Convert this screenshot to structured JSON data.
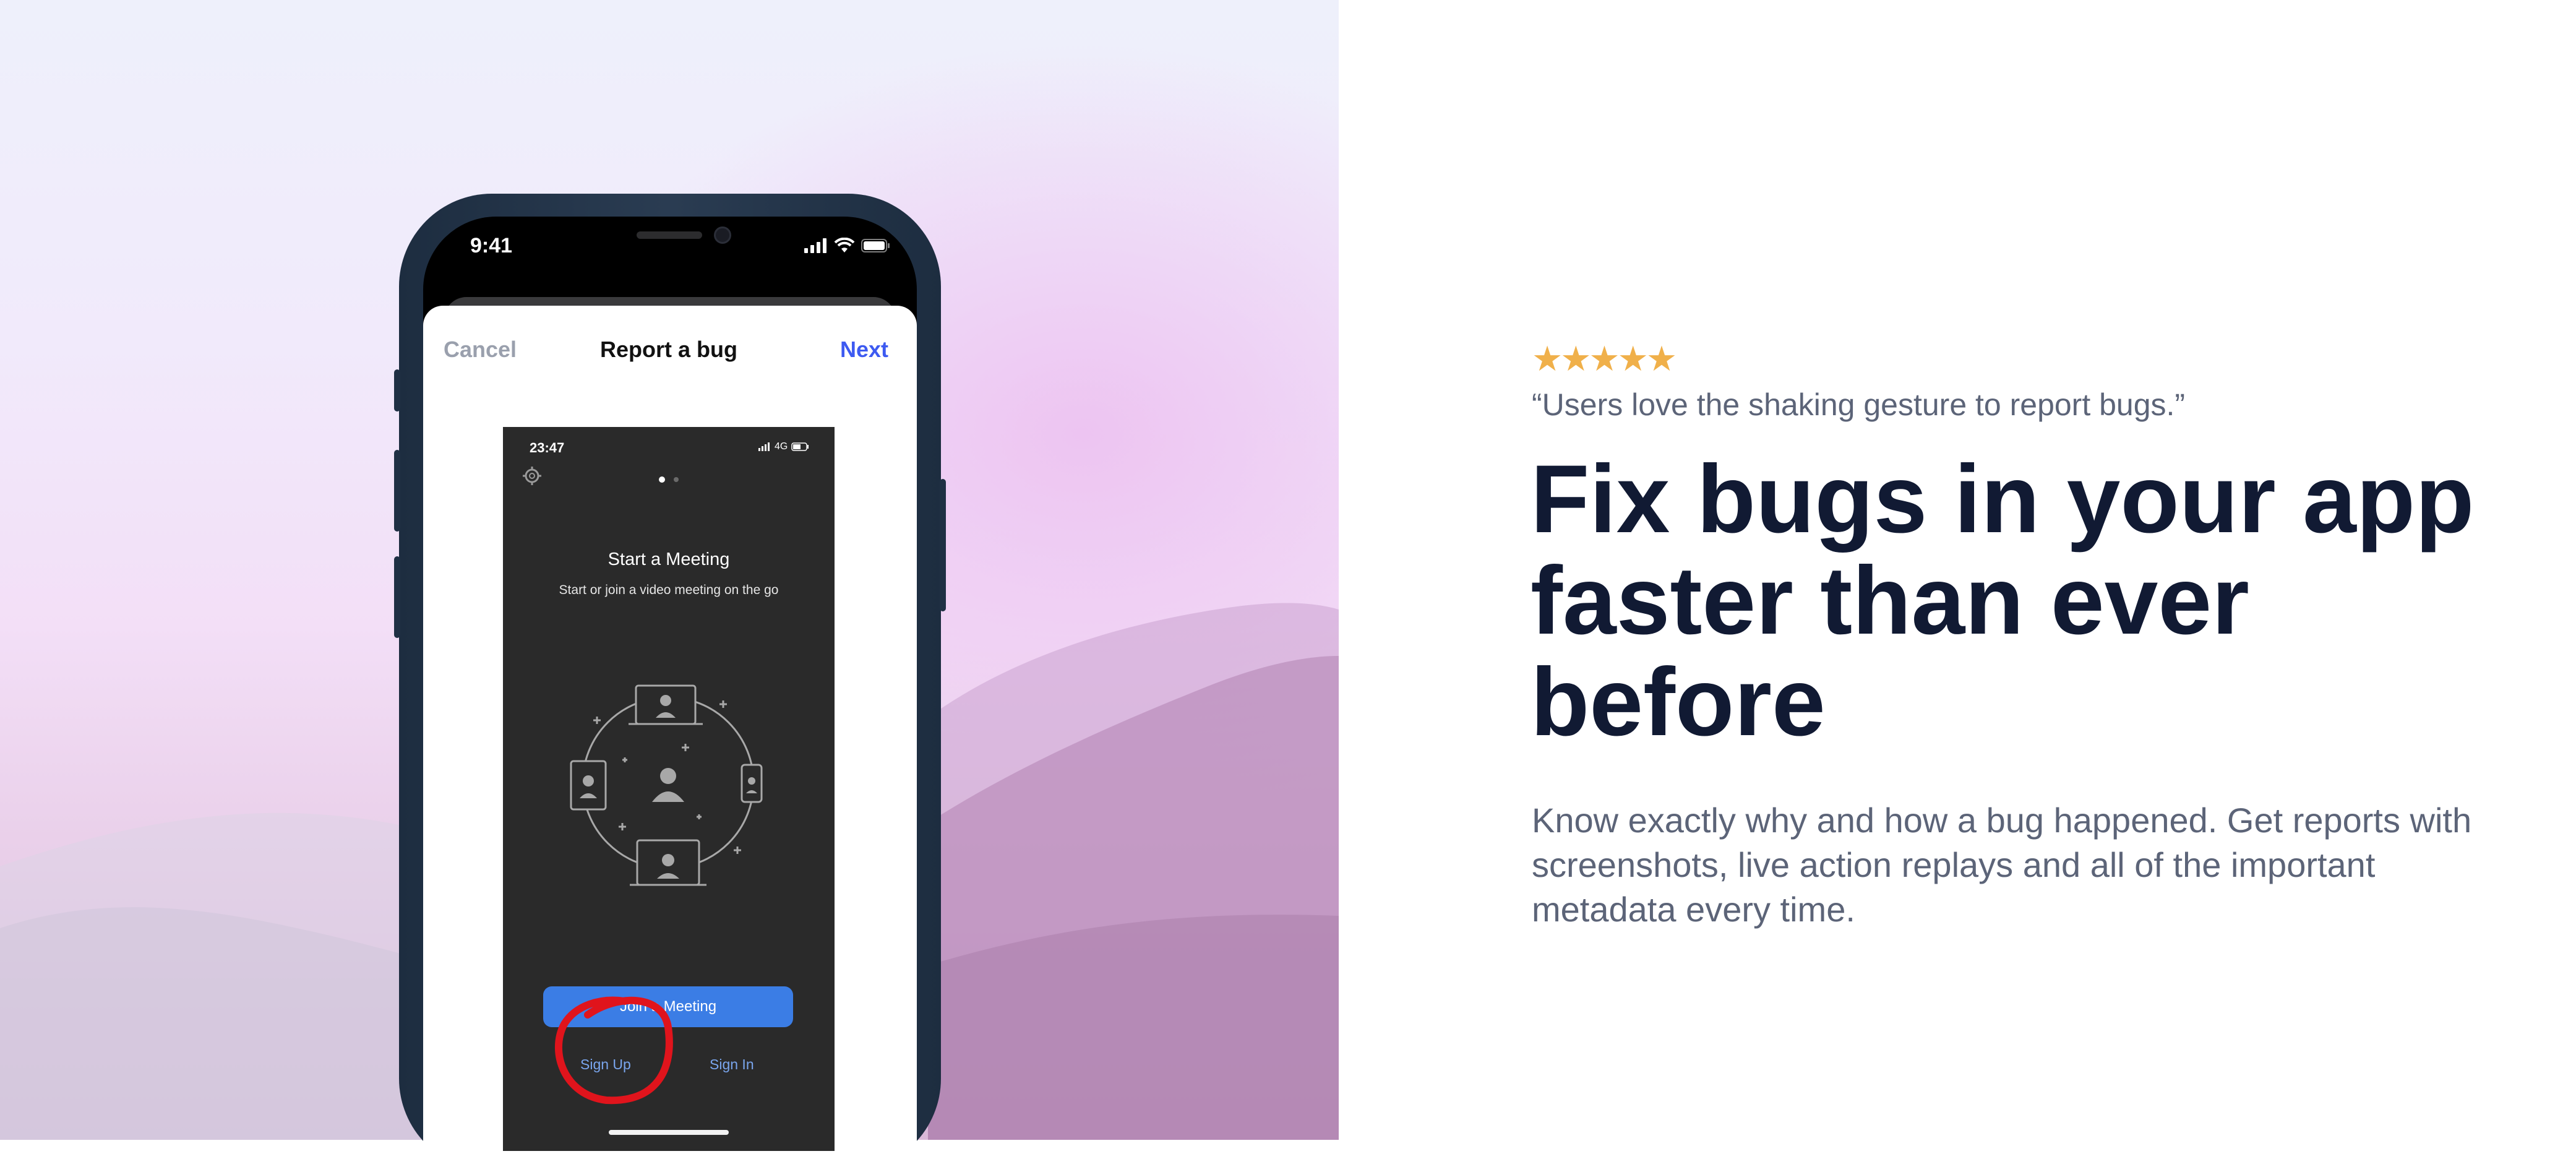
{
  "phone": {
    "status_time": "9:41",
    "sheet": {
      "cancel_label": "Cancel",
      "title": "Report a bug",
      "next_label": "Next"
    },
    "screenshot": {
      "status_time": "23:47",
      "network": "4G",
      "title": "Start a Meeting",
      "subtitle": "Start or join a video meeting on the go",
      "join_button_label": "Join a Meeting",
      "signup_label": "Sign Up",
      "signin_label": "Sign In",
      "annotation_color": "#e0141c"
    }
  },
  "review": {
    "rating": 5,
    "stars_text": "★★★★★",
    "star_color": "#f0b04a",
    "quote": "“Users love the shaking gesture to report bugs.”"
  },
  "headline": "Fix bugs in your app faster than ever before",
  "description": "Know exactly why and how a bug happened. Get reports with screenshots, live action replays and all of the important metadata every time.",
  "colors": {
    "headline": "#111a33",
    "body_text": "#5c6478",
    "accent_blue": "#3d5af1"
  }
}
